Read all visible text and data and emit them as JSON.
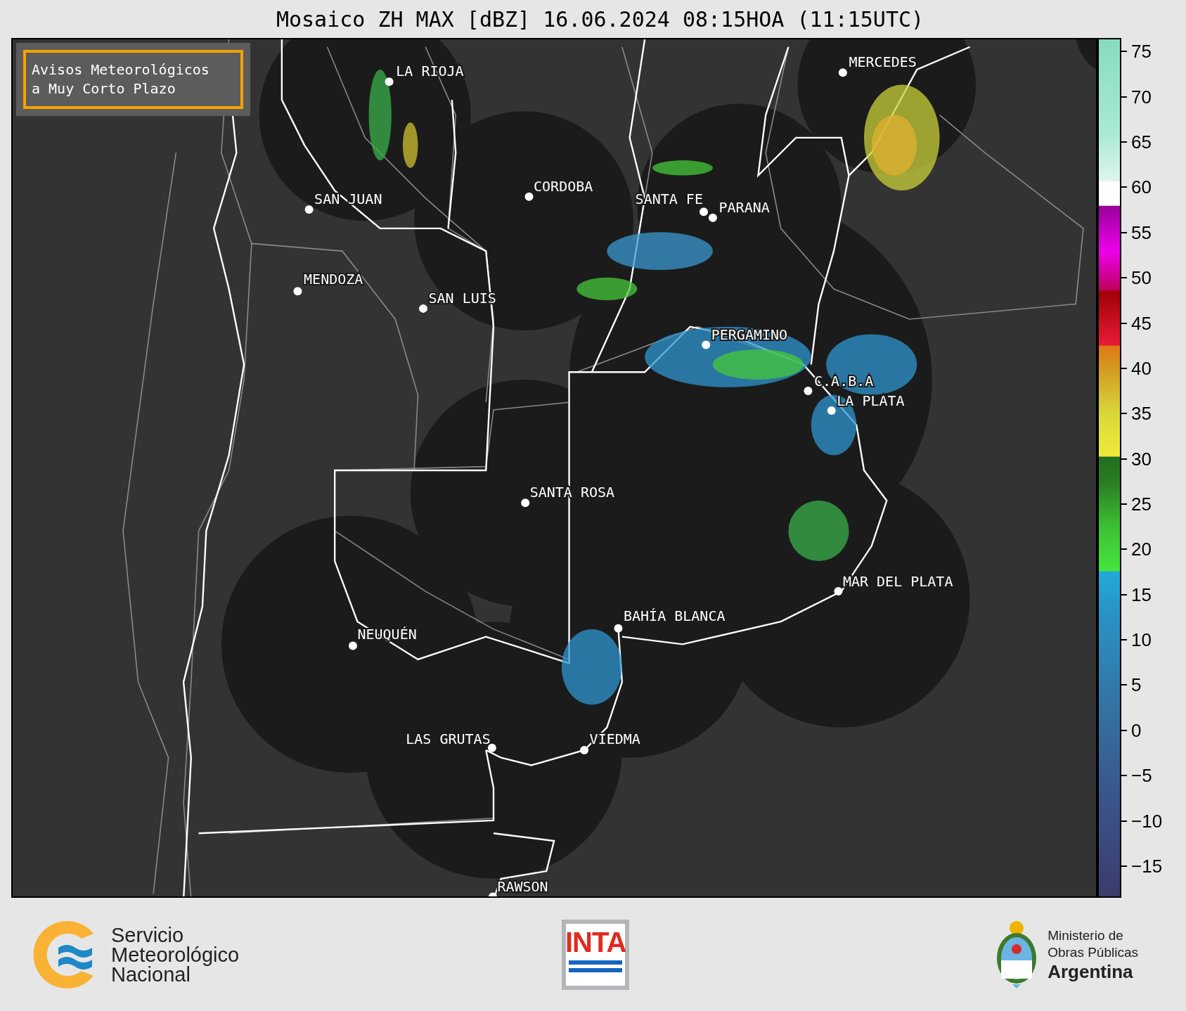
{
  "title": "Mosaico ZH MAX [dBZ] 16.06.2024 08:15HOA (11:15UTC)",
  "legend_box": {
    "lines": [
      "Avisos Meteorológicos",
      "a Muy Corto Plazo"
    ]
  },
  "cities": [
    {
      "name": "LA RIOJA"
    },
    {
      "name": "SAN JUAN"
    },
    {
      "name": "CORDOBA"
    },
    {
      "name": "SANTA FE"
    },
    {
      "name": "PARANA"
    },
    {
      "name": "MERCEDES"
    },
    {
      "name": "MENDOZA"
    },
    {
      "name": "SAN LUIS"
    },
    {
      "name": "PERGAMINO"
    },
    {
      "name": "C.A.B.A"
    },
    {
      "name": "LA PLATA"
    },
    {
      "name": "SANTA ROSA"
    },
    {
      "name": "MAR DEL PLATA"
    },
    {
      "name": "BAHÍA BLANCA"
    },
    {
      "name": "NEUQUÉN"
    },
    {
      "name": "LAS GRUTAS"
    },
    {
      "name": "VIEDMA"
    },
    {
      "name": "RAWSON"
    }
  ],
  "colorbar": {
    "ticks": [
      "75",
      "70",
      "65",
      "60",
      "55",
      "50",
      "45",
      "40",
      "35",
      "30",
      "25",
      "20",
      "15",
      "10",
      "5",
      "0",
      "−5",
      "−10",
      "−15"
    ]
  },
  "footer": {
    "smn_lines": [
      "Servicio",
      "Meteorológico",
      "Nacional"
    ],
    "inta_text": "INTA",
    "ministry_lines": [
      "Ministerio de",
      "Obras Públicas",
      "Argentina"
    ]
  }
}
